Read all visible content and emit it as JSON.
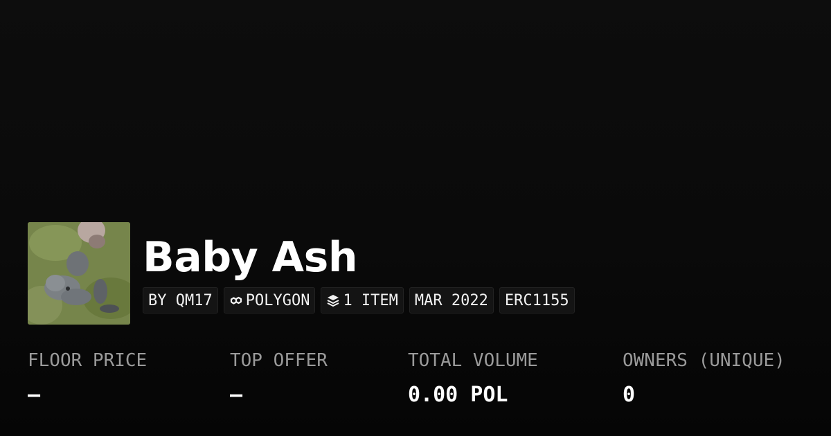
{
  "collection": {
    "title": "Baby Ash",
    "avatar_description": "photo-thumbnail"
  },
  "badges": [
    {
      "label": "BY QM17",
      "icon": null
    },
    {
      "label": "POLYGON",
      "icon": "polygon-chain-icon"
    },
    {
      "label": "1 ITEM",
      "icon": "layers-icon"
    },
    {
      "label": "MAR 2022",
      "icon": null
    },
    {
      "label": "ERC1155",
      "icon": null
    }
  ],
  "stats": [
    {
      "label": "FLOOR PRICE",
      "value": "–"
    },
    {
      "label": "TOP OFFER",
      "value": "–"
    },
    {
      "label": "TOTAL VOLUME",
      "value": "0.00 POL"
    },
    {
      "label": "OWNERS (UNIQUE)",
      "value": "0"
    }
  ],
  "colors": {
    "background": "#0a0a0a",
    "text": "#ffffff",
    "muted": "#9a9a9a",
    "badge_bg": "#141414"
  }
}
